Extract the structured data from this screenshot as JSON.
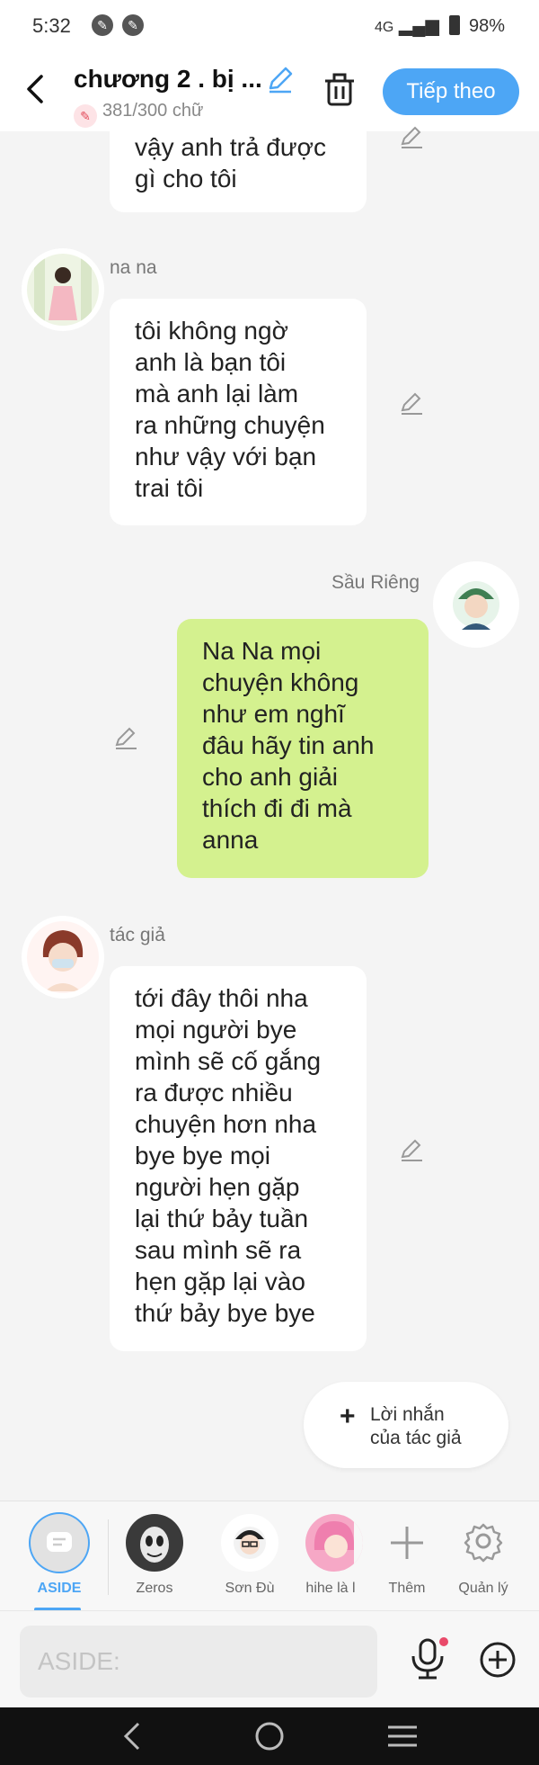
{
  "status_bar": {
    "time": "5:32",
    "network": "4G",
    "battery": "98%"
  },
  "header": {
    "back_icon": "chevron-left-icon",
    "title": "chương 2 . bị ...",
    "word_count": "381/300 chữ",
    "next_label": "Tiếp theo",
    "accent_color": "#4da6f5"
  },
  "messages": [
    {
      "sender": "",
      "side": "left",
      "text": "vậy anh trả được\ngì cho tôi"
    },
    {
      "sender": "na na",
      "side": "left",
      "text": "tôi không ngờ\nanh là bạn tôi\nmà anh lại làm\nra những chuyện\nnhư vậy với bạn\ntrai tôi"
    },
    {
      "sender": "Sầu Riêng",
      "side": "right",
      "text": "Na Na mọi\nchuyện không\nnhư em nghĩ\nđâu hãy tin anh\ncho anh giải\nthích đi đi mà\nanna",
      "bubble_color": "#d4f18f"
    },
    {
      "sender": "tác giả",
      "side": "left",
      "text": "tới đây thôi nha\nmọi người bye\nmình sẽ cố gắng\nra được nhiều\nchuyện hơn nha\nbye bye mọi\nngười hẹn gặp\nlại thứ bảy tuần\nsau mình sẽ ra\nhẹn gặp lại vào\nthứ bảy bye bye"
    }
  ],
  "author_note_button": {
    "label": "Lời nhắn\ncủa tác giả"
  },
  "characters": [
    {
      "label": "ASIDE",
      "active": true
    },
    {
      "label": "Zeros"
    },
    {
      "label": "Sơn Đù"
    },
    {
      "label": "hihe là l"
    }
  ],
  "actions": {
    "add_label": "Thêm",
    "manage_label": "Quản lý"
  },
  "input": {
    "placeholder": "ASIDE:"
  }
}
